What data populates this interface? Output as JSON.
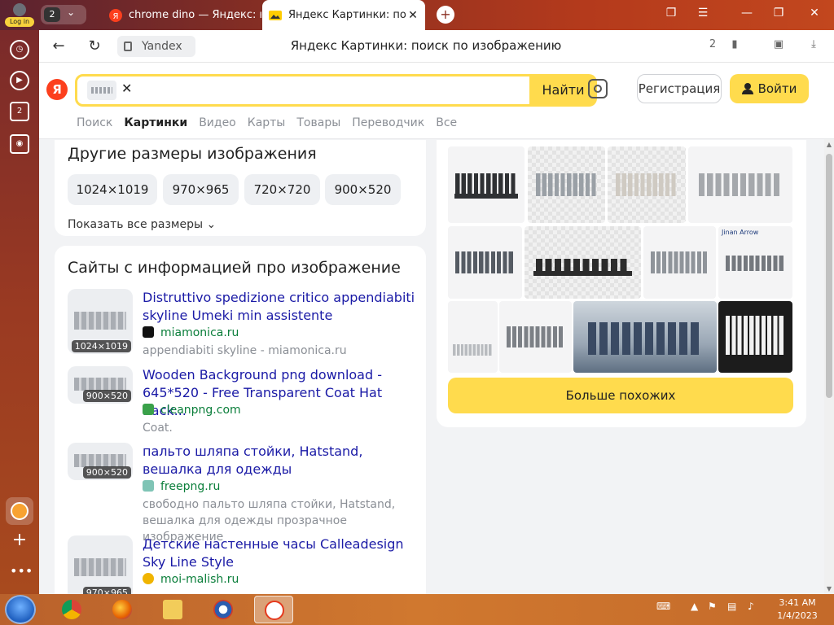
{
  "browser": {
    "login_label": "Log in",
    "tab_count": "2",
    "tabs": [
      {
        "title": "chrome dino — Яндекс: на"
      },
      {
        "title": "Яндекс Картинки: поис"
      }
    ],
    "domain": "Yandex",
    "page_title": "Яндекс Картинки: поиск по изображению",
    "downloads_badge": "2",
    "rail_tabs_count": "2"
  },
  "yandex": {
    "logo": "Я",
    "search_button": "Найти",
    "register_button": "Регистрация",
    "login_button": "Войти",
    "services": [
      "Поиск",
      "Картинки",
      "Видео",
      "Карты",
      "Товары",
      "Переводчик",
      "Все"
    ],
    "active_service": "Картинки"
  },
  "other_sizes": {
    "title": "Другие размеры изображения",
    "sizes": [
      "1024×1019",
      "970×965",
      "720×720",
      "900×520"
    ],
    "show_all": "Показать все размеры"
  },
  "sites": {
    "title": "Сайты с информацией про изображение",
    "items": [
      {
        "title": "Distruttivo spedizione critico appendiabiti skyline Umeki min assistente",
        "domain": "miamonica.ru",
        "desc": "appendiabiti skyline - miamonica.ru",
        "size": "1024×1019",
        "favicon_color": "#111111"
      },
      {
        "title": "Wooden Background png download - 645*520 - Free Transparent Coat Hat Rack...",
        "domain": "cleanpng.com",
        "desc": "Coat.",
        "size": "900×520",
        "favicon_color": "#3aa14a"
      },
      {
        "title": "пальто шляпа стойки, Hatstand, вешалка для одежды",
        "domain": "freepng.ru",
        "desc": "свободно пальто шляпа стойки, Hatstand, вешалка для одежды прозрачное изображение",
        "size": "900×520",
        "favicon_color": "#7fc4b5"
      },
      {
        "title": "Детские настенные часы Calleadesign Sky Line Style",
        "domain": "moi-malish.ru",
        "desc": "",
        "size": "970×965",
        "favicon_color": "#f0b400"
      }
    ]
  },
  "similar": {
    "more_button": "Больше похожих",
    "tile_caption": "Jinan Arrow"
  },
  "taskbar": {
    "time": "3:41 AM",
    "date": "1/4/2023"
  }
}
